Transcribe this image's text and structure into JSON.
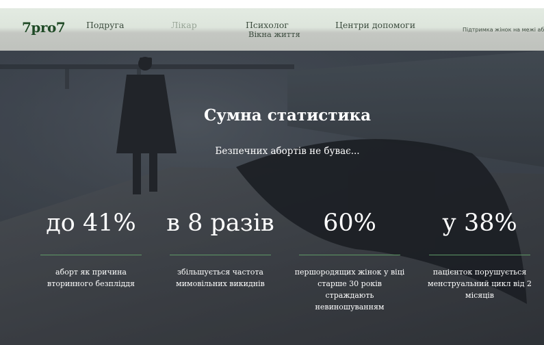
{
  "top_strip": {
    "text": ""
  },
  "header": {
    "logo": "7pro7",
    "nav": [
      {
        "label": "Подруга"
      },
      {
        "label": "Лікар"
      },
      {
        "label": "Психолог"
      },
      {
        "label": "Центри допомоги"
      }
    ],
    "sub_nav": "Вікна життя",
    "tagline": "Підтримка жінок на межі аборт"
  },
  "hero": {
    "title": "Сумна статистика",
    "subtitle": "Безпечних абортів не буває...",
    "stats": [
      {
        "value": "до 41%",
        "description": "аборт як причина вторинного безпліддя"
      },
      {
        "value": "в 8 разів",
        "description": "збільшується частота мимовільних викиднів"
      },
      {
        "value": "60%",
        "description": "першородящих жінок у віці старше 30 років страждають невиношуванням"
      },
      {
        "value": "у 38%",
        "description": "пацієнток порушується менструальний цикл від 2 місяців"
      }
    ]
  },
  "colors": {
    "logo": "#1f4a26",
    "header_bg": "#e3ebe2",
    "stat_underline": "#5f9a66",
    "hero_overlay": "#3e4650"
  }
}
